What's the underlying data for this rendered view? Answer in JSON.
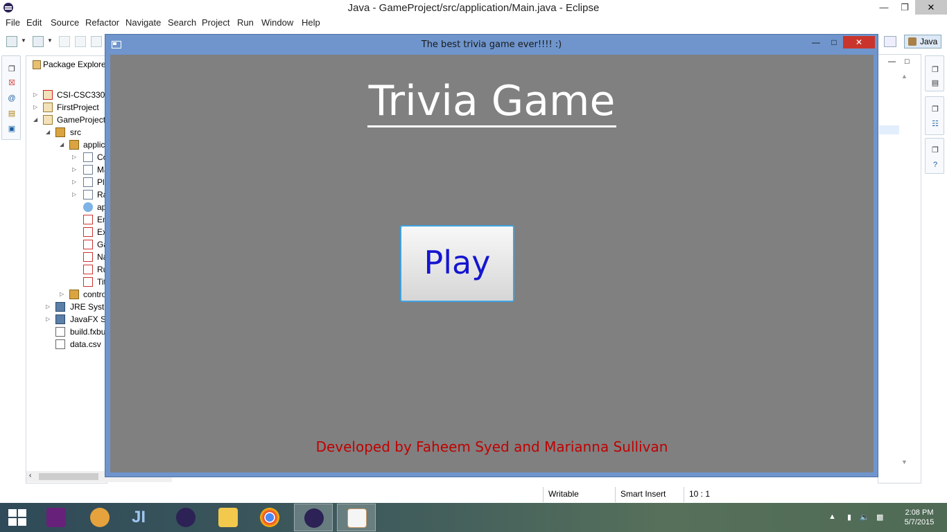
{
  "eclipse": {
    "window_title": "Java - GameProject/src/application/Main.java - Eclipse",
    "menu": [
      "File",
      "Edit",
      "Source",
      "Refactor",
      "Navigate",
      "Search",
      "Project",
      "Run",
      "Window",
      "Help"
    ],
    "perspective": "Java"
  },
  "package_explorer": {
    "tab_label": "Package Explorer",
    "tree": [
      {
        "label": "CSI-CSC330",
        "icon": "project-error-icon"
      },
      {
        "label": "FirstProject",
        "icon": "project-icon"
      },
      {
        "label": "GameProject",
        "icon": "project-icon"
      },
      {
        "label": "src",
        "icon": "source-folder-icon"
      },
      {
        "label": "applic",
        "icon": "package-icon"
      },
      {
        "label": "Co",
        "icon": "java-file-icon"
      },
      {
        "label": "Ma",
        "icon": "java-file-icon"
      },
      {
        "label": "Pla",
        "icon": "java-file-icon"
      },
      {
        "label": "Ra",
        "icon": "java-file-icon"
      },
      {
        "label": "ap",
        "icon": "css-file-icon"
      },
      {
        "label": "En",
        "icon": "fxml-file-icon"
      },
      {
        "label": "Ex",
        "icon": "fxml-file-icon"
      },
      {
        "label": "Ga",
        "icon": "fxml-file-icon"
      },
      {
        "label": "Na",
        "icon": "fxml-file-icon"
      },
      {
        "label": "Ru",
        "icon": "fxml-file-icon"
      },
      {
        "label": "Tit",
        "icon": "fxml-file-icon"
      },
      {
        "label": "contro",
        "icon": "package-icon"
      },
      {
        "label": "JRE Systen",
        "icon": "library-icon"
      },
      {
        "label": "JavaFX SD",
        "icon": "library-icon"
      },
      {
        "label": "build.fxbu",
        "icon": "build-file-icon"
      },
      {
        "label": "data.csv",
        "icon": "file-icon"
      }
    ]
  },
  "status_bar": {
    "mode": "Writable",
    "insert": "Smart Insert",
    "position": "10 : 1"
  },
  "trivia_window": {
    "title": "The best trivia game ever!!!!  :)",
    "heading": "Trivia Game",
    "play_label": "Play",
    "credits": "Developed by Faheem Syed and Marianna Sullivan",
    "colors": {
      "background": "#808080",
      "title_bar": "#6f95cc",
      "heading": "#ffffff",
      "play_text": "#1515d0",
      "credits": "#c00000"
    }
  },
  "taskbar": {
    "apps": [
      "visual-studio-icon",
      "android-studio-icon",
      "intellij-icon",
      "eclipse-icon",
      "file-explorer-icon",
      "chrome-icon",
      "eclipse-icon",
      "java-icon"
    ],
    "time": "2:08 PM",
    "date": "5/7/2015"
  }
}
